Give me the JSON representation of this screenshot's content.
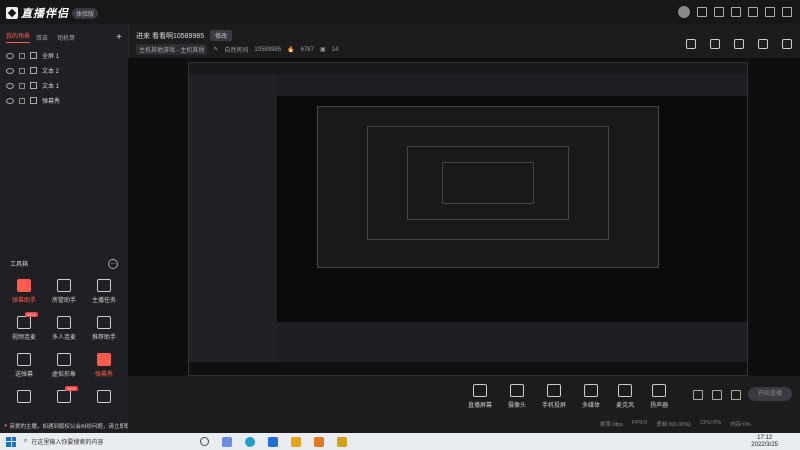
{
  "app": {
    "name": "直播伴侣",
    "badge": "体验版"
  },
  "left": {
    "tabs": [
      "我的场景",
      "双击",
      "司机哥"
    ],
    "sources": [
      "全屏 1",
      "文本 2",
      "文本 1",
      "弹幕秀"
    ],
    "toolbox_title": "工具箱",
    "tools": [
      {
        "label": "弹幕助手",
        "red": true,
        "tag": ""
      },
      {
        "label": "房管助手",
        "red": false,
        "tag": ""
      },
      {
        "label": "主播任务",
        "red": false,
        "tag": ""
      },
      {
        "label": "视频连麦",
        "red": false,
        "tag": "NEW"
      },
      {
        "label": "多人连麦",
        "red": false,
        "tag": ""
      },
      {
        "label": "推荐助手",
        "red": false,
        "tag": ""
      },
      {
        "label": "送弹幕",
        "red": false,
        "tag": ""
      },
      {
        "label": "虚拟形象",
        "red": false,
        "tag": ""
      },
      {
        "label": "弹幕秀",
        "red": true,
        "tag": ""
      },
      {
        "label": "",
        "red": false,
        "tag": ""
      },
      {
        "label": "",
        "red": false,
        "tag": "NEW"
      },
      {
        "label": "",
        "red": false,
        "tag": ""
      }
    ]
  },
  "header": {
    "title": "进来 看看啊10589985",
    "edit": "修改",
    "category": "主机其他游戏 - 主机其他",
    "room_label": "自然房间",
    "room_id": "10589985",
    "likes": "6787",
    "viewers": "14"
  },
  "controls": [
    "直播屏幕",
    "摄像头",
    "手机投屏",
    "多媒体",
    "麦克风",
    "扬声器"
  ],
  "go_live": "开始直播",
  "stats": [
    "帧率:0fps",
    "FPS:0",
    "丢帧:0(0.00%)",
    "CPU:0%",
    "内存:0%"
  ],
  "notice": "亲爱的主播，如遇到版权公会纠纷问题，请立即联系专职客服",
  "taskbar": {
    "search": "在这里输入你要搜索的内容",
    "time": "17:12",
    "date": "2022/3/25"
  },
  "colors": {
    "accent": "#ff5b4a",
    "bg": "#1c1c1f",
    "taskbar": "#e9ecf1"
  }
}
